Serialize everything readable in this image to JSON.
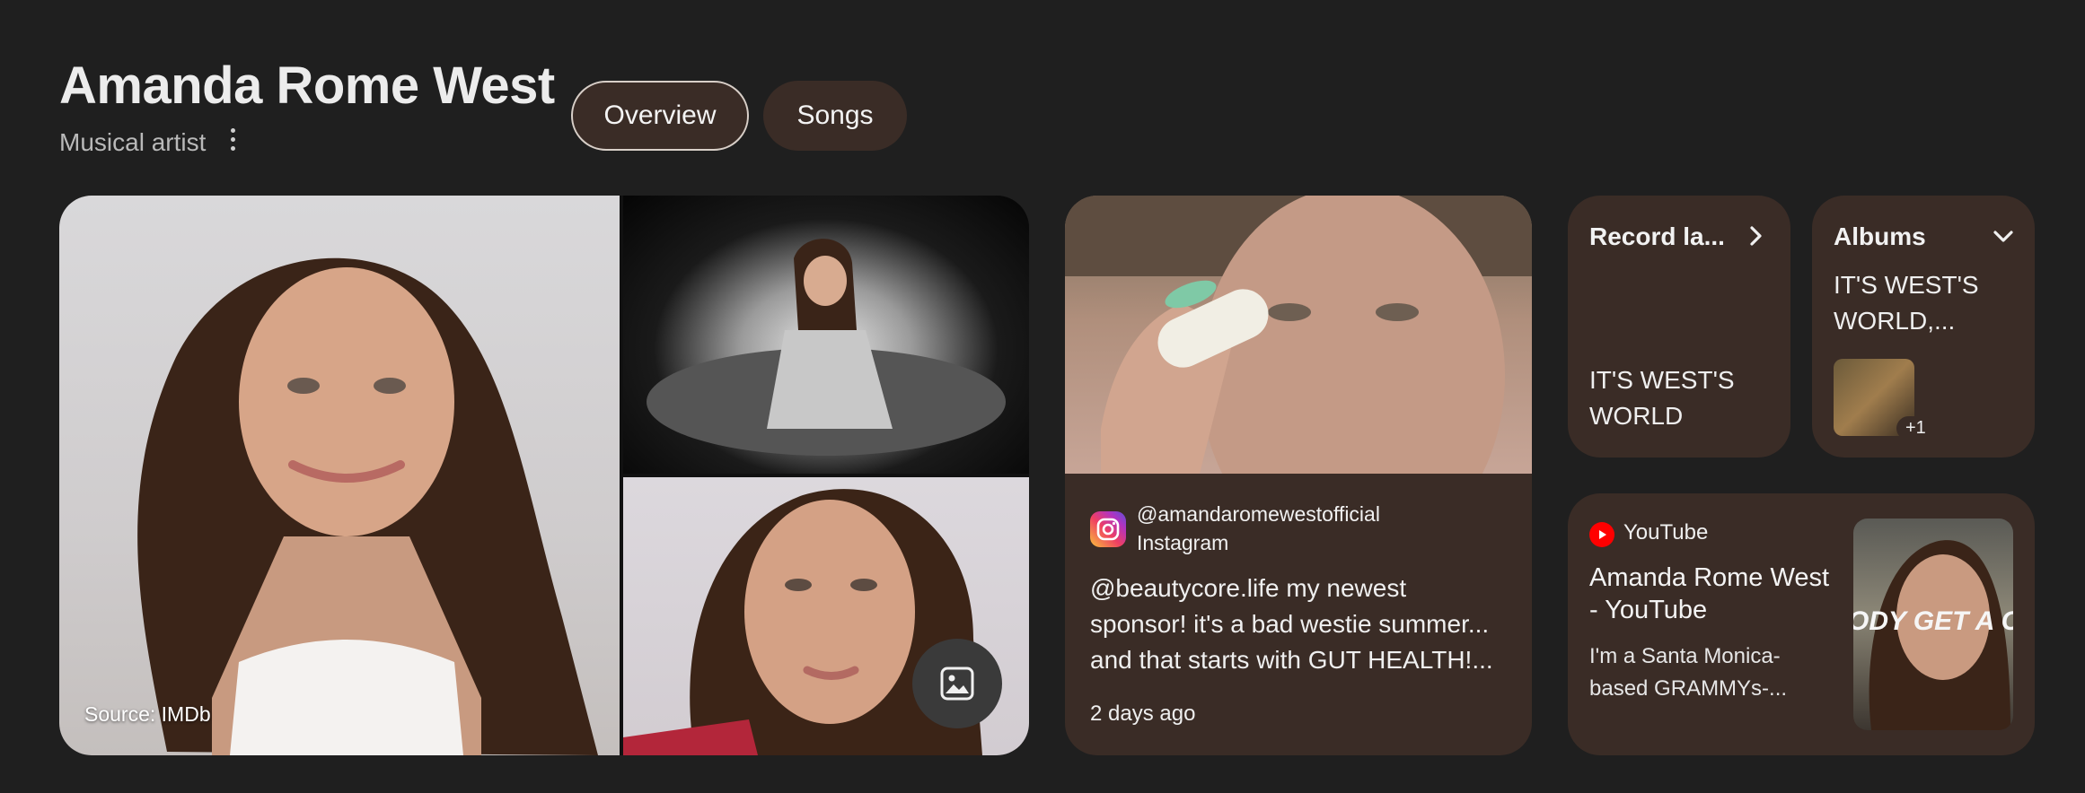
{
  "header": {
    "title": "Amanda Rome West",
    "subtitle": "Musical artist",
    "more_icon": "more-vert-icon"
  },
  "tabs": [
    {
      "label": "Overview",
      "selected": true
    },
    {
      "label": "Songs",
      "selected": false
    }
  ],
  "images": {
    "source": "Source: IMDb",
    "gallery_icon": "image-icon"
  },
  "instagram": {
    "handle": "@amandaromewestofficial",
    "source": "Instagram",
    "caption_lines": [
      "@beautycore.life my newest",
      "sponsor! it's a bad westie summer...",
      "and that starts with GUT HEALTH!..."
    ],
    "time": "2 days ago"
  },
  "record_label": {
    "heading": "Record la...",
    "value": "IT'S WEST'S WORLD",
    "icon": "chevron-right-icon"
  },
  "albums": {
    "heading": "Albums",
    "title": "IT'S WEST'S WORLD,...",
    "more_count": "+1",
    "icon": "chevron-down-icon"
  },
  "youtube": {
    "source": "YouTube",
    "title": "Amanda Rome West - YouTube",
    "description": "I'm a Santa Monica-based GRAMMYs-...",
    "thumb_text": "ODY GET A C"
  },
  "colors": {
    "background": "#1f1f1f",
    "card": "#3a2c26",
    "youtube_red": "#ff0000"
  }
}
